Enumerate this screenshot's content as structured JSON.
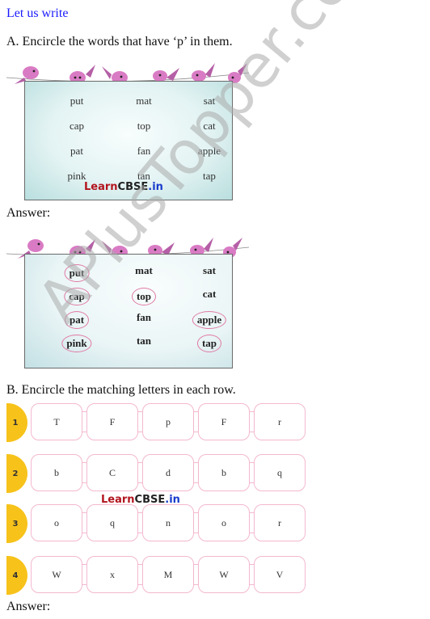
{
  "section_title": "Let us write",
  "question_a": {
    "prompt": "A. Encircle the words that have ‘p’ in them.",
    "words": [
      [
        "put",
        "mat",
        "sat"
      ],
      [
        "cap",
        "top",
        "cat"
      ],
      [
        "pat",
        "fan",
        "apple"
      ],
      [
        "pink",
        "tan",
        "tap"
      ]
    ],
    "answer_label": "Answer:",
    "answer_circled": [
      [
        true,
        false,
        false
      ],
      [
        true,
        true,
        false
      ],
      [
        true,
        false,
        true
      ],
      [
        true,
        false,
        true
      ]
    ]
  },
  "question_b": {
    "prompt": "B. Encircle the matching letters in each row.",
    "rows": [
      {
        "number": "1",
        "letters": [
          "T",
          "F",
          "p",
          "F",
          "r"
        ]
      },
      {
        "number": "2",
        "letters": [
          "b",
          "C",
          "d",
          "b",
          "q"
        ]
      },
      {
        "number": "3",
        "letters": [
          "o",
          "q",
          "n",
          "o",
          "r"
        ]
      },
      {
        "number": "4",
        "letters": [
          "W",
          "x",
          "M",
          "W",
          "V"
        ]
      }
    ],
    "answer_label": "Answer:"
  },
  "branding": {
    "learn": "Learn",
    "cbse": "CBSE",
    "in": ".in"
  },
  "watermark": "APlusTopper.com",
  "colors": {
    "title_blue": "#1a1aff",
    "circle_pink": "#e07aa4",
    "tab_yellow": "#f7c21a",
    "cell_border_pink": "#f3b8cf"
  }
}
